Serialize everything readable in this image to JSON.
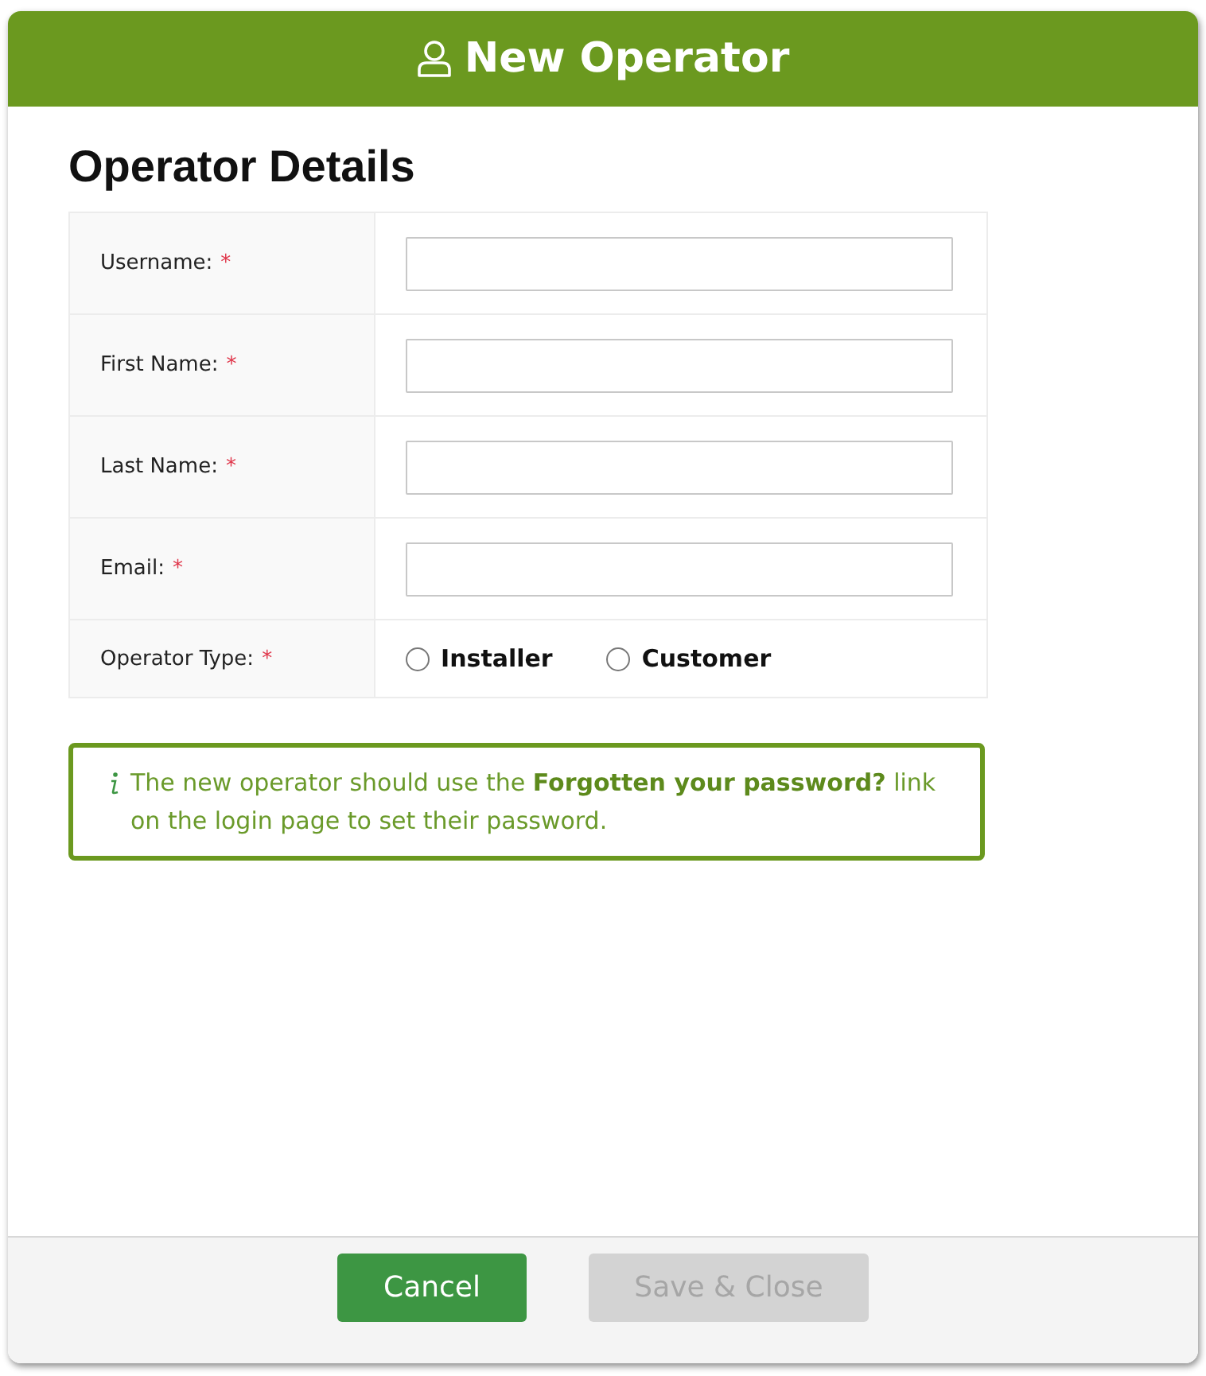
{
  "dialog": {
    "title": "New Operator"
  },
  "section": {
    "title": "Operator Details"
  },
  "fields": [
    {
      "kind": "text",
      "label": "Username:",
      "required_marker": "*"
    },
    {
      "kind": "text",
      "label": "First Name:",
      "required_marker": "*"
    },
    {
      "kind": "text",
      "label": "Last Name:",
      "required_marker": "*"
    },
    {
      "kind": "text",
      "label": "Email:",
      "required_marker": "*"
    },
    {
      "kind": "radio",
      "label": "Operator Type:",
      "required_marker": "*",
      "options": [
        {
          "label": "Installer",
          "selected": false
        },
        {
          "label": "Customer",
          "selected": false
        }
      ]
    }
  ],
  "info": {
    "text": "The new operator should use the **Forgotten your password?** link on the login page to set their password."
  },
  "buttons": [
    {
      "label": "Cancel",
      "disabled": false
    },
    {
      "label": "Save & Close",
      "disabled": true
    }
  ]
}
